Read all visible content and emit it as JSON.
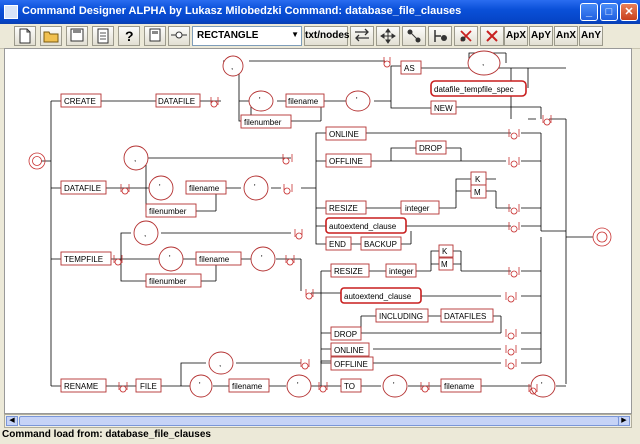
{
  "window": {
    "title": "Command Designer ALPHA by Lukasz Milobedzki Command: database_file_clauses",
    "minimize_label": "_",
    "maximize_label": "□",
    "close_label": "✕"
  },
  "toolbar": {
    "shape_select_value": "RECTANGLE",
    "txt_nodes_label": "txt/nodes",
    "apx_label": "ApX",
    "apy_label": "ApY",
    "anx_label": "AnX",
    "any_label": "AnY",
    "icons": [
      "new-file-icon",
      "open-folder-icon",
      "save-icon",
      "document-icon",
      "help-icon",
      "save-as-icon",
      "connector-icon",
      "swap-icon",
      "move-icon",
      "node-add-icon",
      "node-delete-icon",
      "delete-icon"
    ]
  },
  "diagram": {
    "create": "CREATE",
    "datafile_kw": "DATAFILE",
    "comma": ",",
    "quote": "'",
    "filename": "filename",
    "filenumber": "filenumber",
    "as": "AS",
    "datafile_tempfile_spec": "datafile_tempfile_spec",
    "new": "NEW",
    "datafile_alt": "DATAFILE",
    "online": "ONLINE",
    "offline": "OFFLINE",
    "drop": "DROP",
    "resize": "RESIZE",
    "integer": "integer",
    "k": "K",
    "m": "M",
    "autoextend_clause": "autoextend_clause",
    "end": "END",
    "backup": "BACKUP",
    "tempfile": "TEMPFILE",
    "including": "INCLUDING",
    "datafiles": "DATAFILES",
    "rename": "RENAME",
    "file": "FILE",
    "to": "TO"
  },
  "status": {
    "message": "Command load from: database_file_clauses"
  }
}
